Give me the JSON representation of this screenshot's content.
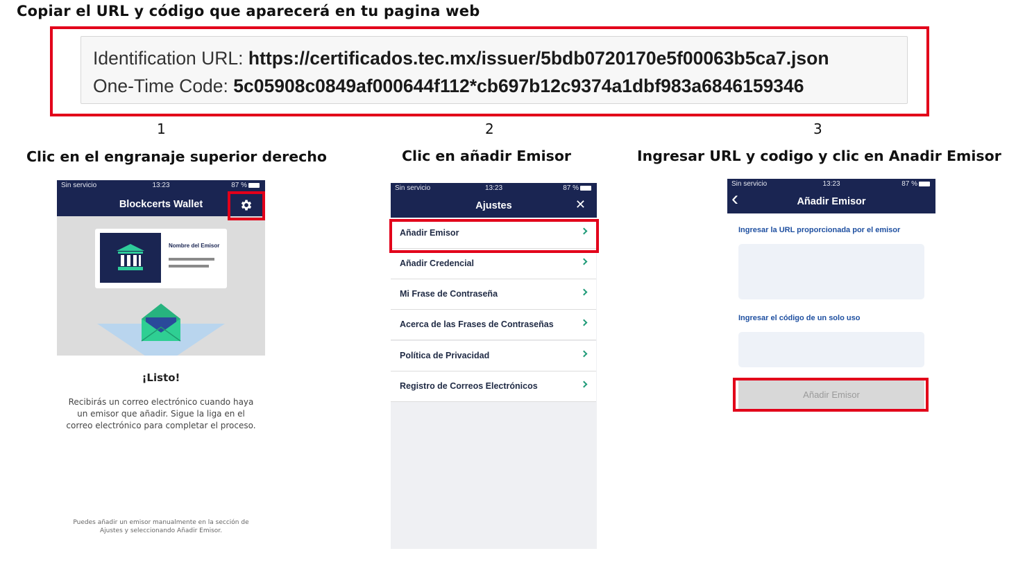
{
  "main_title": "Copiar el URL y código que aparecerá en tu pagina web",
  "url_box": {
    "url_label": "Identification URL:",
    "url_value": "https://certificados.tec.mx/issuer/5bdb0720170e5f00063b5ca7.json",
    "code_label": "One-Time Code:",
    "code_value": "5c05908c0849af000644f112*cb697b12c9374a1dbf983a6846159346"
  },
  "steps": [
    {
      "number": "1",
      "title": "Clic en el engranaje superior derecho"
    },
    {
      "number": "2",
      "title": "Clic en añadir Emisor"
    },
    {
      "number": "3",
      "title": "Ingresar URL y codigo y clic en Anadir Emisor"
    }
  ],
  "status_bar": {
    "carrier": "Sin servicio",
    "time": "13:23",
    "battery": "87 %"
  },
  "screen1": {
    "nav_title": "Blockcerts Wallet",
    "card_issuer": "Nombre del Emisor",
    "ready_title": "¡Listo!",
    "ready_body": "Recibirás un correo electrónico cuando haya un emisor que añadir. Sigue la liga en el correo electrónico para completar el proceso.",
    "footer_note": "Puedes añadir un emisor manualmente en la sección de Ajustes y seleccionando Añadir Emisor."
  },
  "screen2": {
    "nav_title": "Ajustes",
    "close_glyph": "✕",
    "items": [
      {
        "label": "Añadir Emisor"
      },
      {
        "label": "Añadir Credencial"
      },
      {
        "label": "Mi Frase de Contraseña"
      },
      {
        "label": "Acerca de las Frases de Contraseñas"
      },
      {
        "label": "Política de Privacidad"
      },
      {
        "label": "Registro de Correos Electrónicos"
      }
    ]
  },
  "screen3": {
    "nav_title": "Añadir Emisor",
    "back_glyph": "‹",
    "url_label": "Ingresar la URL proporcionada por el emisor",
    "code_label": "Ingresar el código de un solo uso",
    "button_label": "Añadir Emisor"
  },
  "colors": {
    "navy": "#1a2552",
    "highlight_red": "#e2001a",
    "accent_green": "#1f9b78",
    "label_blue": "#1e4fa0"
  }
}
